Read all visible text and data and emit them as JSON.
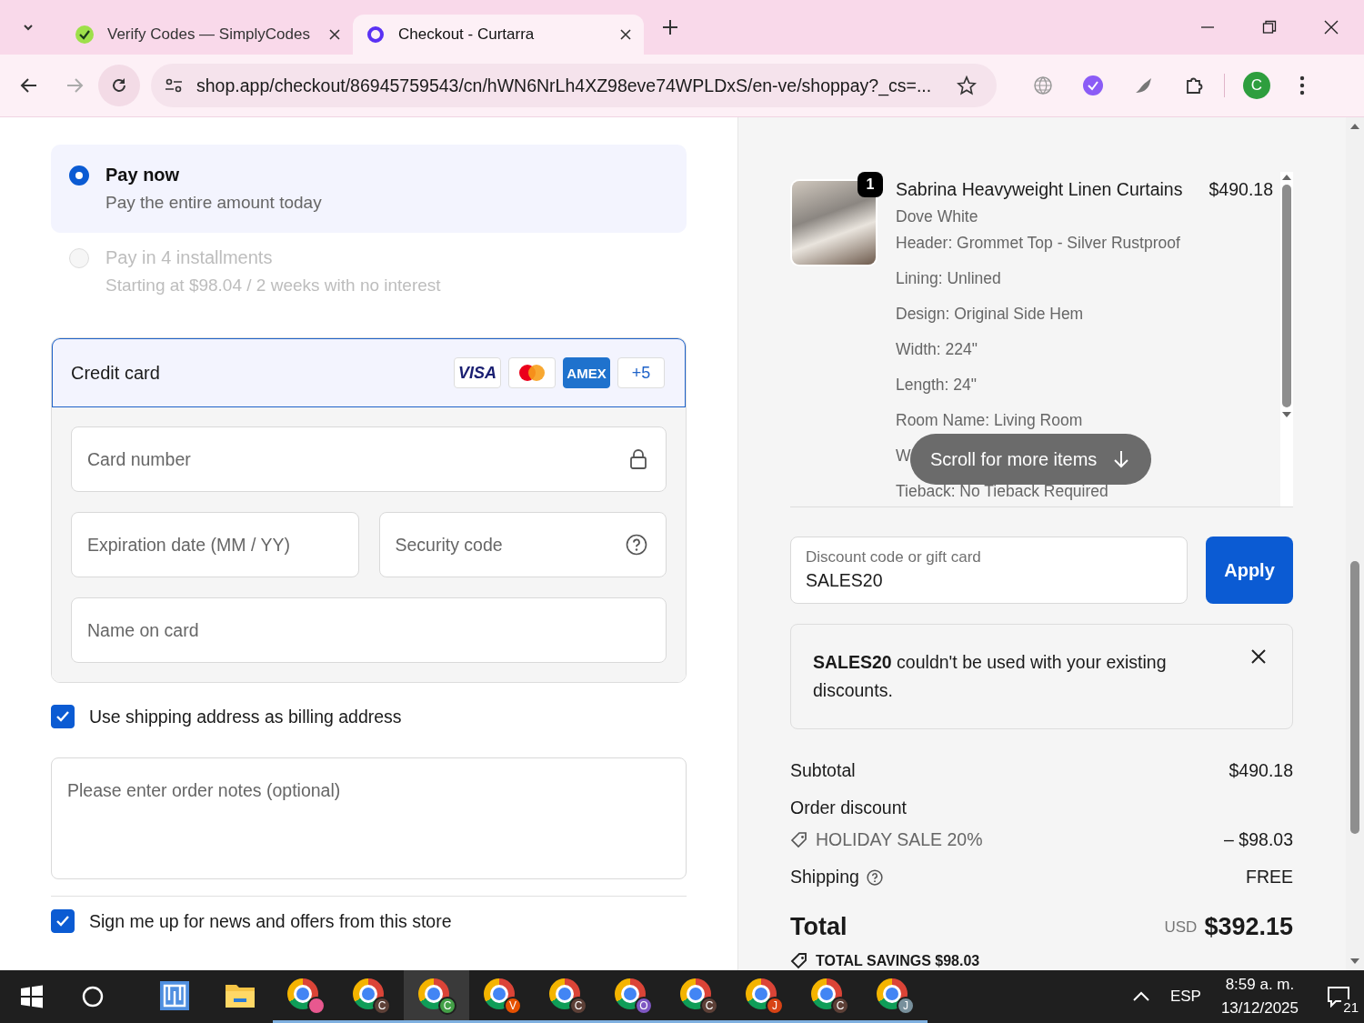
{
  "browser": {
    "tabs": [
      {
        "title": "Verify Codes — SimplyCodes",
        "selected": false,
        "kind": "simplycodes"
      },
      {
        "title": "Checkout - Curtarra",
        "selected": true,
        "kind": "shop"
      }
    ],
    "url": "shop.app/checkout/86945759543/cn/hWN6NrLh4XZ98eve74WPLDxS/en-ve/shoppay?_cs=...",
    "profile_initial": "C"
  },
  "payment_options": [
    {
      "title": "Pay now",
      "subtitle": "Pay the entire amount today",
      "selected": true,
      "disabled": false
    },
    {
      "title": "Pay in 4 installments",
      "subtitle": "Starting at $98.04 / 2 weeks with no interest",
      "selected": false,
      "disabled": true
    }
  ],
  "payment_method": {
    "label": "Credit card",
    "brands": [
      {
        "kind": "visa",
        "label": "VISA"
      },
      {
        "kind": "mastercard"
      },
      {
        "kind": "amex",
        "label": "AMEX"
      },
      {
        "kind": "more",
        "label": "+5"
      }
    ],
    "fields": [
      {
        "placeholder": "Card number",
        "kind": "lock"
      },
      {
        "placeholder": "Expiration date (MM / YY)",
        "kind": "plain"
      },
      {
        "placeholder": "Security code",
        "kind": "help"
      },
      {
        "placeholder": "Name on card",
        "kind": "plain"
      }
    ]
  },
  "billing_same": {
    "label": "Use shipping address as billing address",
    "checked": true
  },
  "notes": {
    "placeholder": "Please enter order notes (optional)"
  },
  "newsletter": {
    "label": "Sign me up for news and offers from this store",
    "checked": true
  },
  "order": {
    "item": {
      "quantity": "1",
      "name": "Sabrina Heavyweight Linen Curtains",
      "price": "$490.18",
      "options": [
        "Dove White",
        "Header: Grommet Top - Silver Rustproof",
        "Lining: Unlined",
        "Design: Original Side Hem",
        "Width: 224\"",
        "Length: 24\"",
        "Room Name: Living Room",
        "W",
        "Tieback: No Tieback Required"
      ]
    },
    "scroll_hint": "Scroll for more items",
    "discount": {
      "label": "Discount code or gift card",
      "value": "SALES20",
      "button": "Apply"
    },
    "error": {
      "message": "**SALES20** couldn't be used with your existing discounts."
    },
    "summary": {
      "subtotal_label": "Subtotal",
      "subtotal": "$490.18",
      "discount_label": "Order discount",
      "discount_code": "HOLIDAY SALE 20%",
      "discount_amount": "– $98.03",
      "shipping_label": "Shipping",
      "shipping": "FREE",
      "total_label": "Total",
      "currency": "USD",
      "total": "$392.15",
      "savings": "TOTAL SAVINGS $98.03"
    }
  },
  "taskbar": {
    "apps": [
      {
        "kind": "tiles",
        "selected": false
      },
      {
        "kind": "folder",
        "selected": false
      },
      {
        "kind": "chrome",
        "color": "#e8588f",
        "selected": false
      },
      {
        "kind": "chrome",
        "badge": "C",
        "color": "#5d4037",
        "selected": false
      },
      {
        "kind": "chrome",
        "badge": "C",
        "color": "#43a047",
        "selected": true
      },
      {
        "kind": "chrome",
        "badge": "V",
        "color": "#e65100",
        "selected": false
      },
      {
        "kind": "chrome",
        "badge": "C",
        "color": "#5d4037",
        "selected": false
      },
      {
        "kind": "chrome",
        "badge": "O",
        "color": "#7e57c2",
        "selected": false
      },
      {
        "kind": "chrome",
        "badge": "C",
        "color": "#5d4037",
        "selected": false
      },
      {
        "kind": "chrome",
        "badge": "J",
        "color": "#d84315",
        "selected": false
      },
      {
        "kind": "chrome",
        "badge": "C",
        "color": "#5d4037",
        "selected": false
      },
      {
        "kind": "chrome",
        "badge": "J",
        "color": "#78909c",
        "selected": false
      }
    ],
    "language": "ESP",
    "time": "8:59 a. m.",
    "date": "13/12/2025",
    "notifications": "21"
  }
}
